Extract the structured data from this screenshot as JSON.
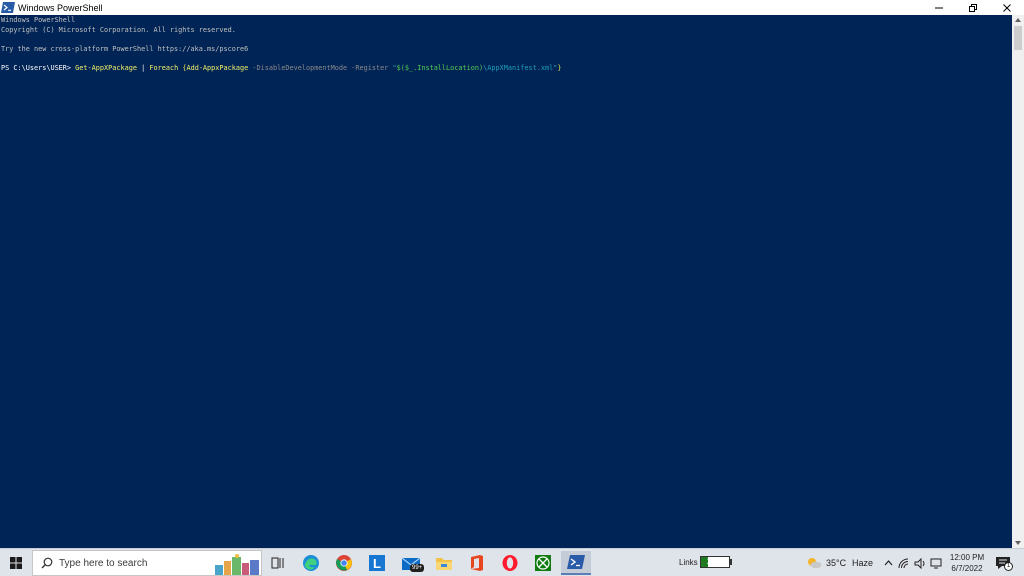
{
  "window": {
    "title": "Windows PowerShell"
  },
  "console": {
    "lines": [
      "Windows PowerShell",
      "Copyright (C) Microsoft Corporation. All rights reserved.",
      "",
      "Try the new cross-platform PowerShell https://aka.ms/pscore6",
      ""
    ],
    "prompt": "PS C:\\Users\\USER> ",
    "command": {
      "cmdlet1": "Get-AppXPackage",
      "pipe": " | ",
      "foreach": "Foreach",
      "space": " ",
      "open_brace": "{",
      "cmdlet2": "Add-AppxPackage",
      "param1": " -DisableDevelopmentMode",
      "param2": " -Register",
      "quote_open": " \"",
      "var_expr": "$($_.InstallLocation)",
      "path": "\\AppXManifest.xml",
      "quote_close": "\"",
      "close_brace": "}"
    }
  },
  "taskbar": {
    "search_placeholder": "Type here to search",
    "mail_badge": "99+",
    "links_label": "Links",
    "battery_percent": "25%",
    "battery_level": 0.25,
    "weather_temp": "35°C",
    "weather_desc": "Haze",
    "time": "12:00 PM",
    "date": "6/7/2022",
    "notification_count": "1"
  },
  "colors": {
    "console_bg": "#012456",
    "cmdlet": "#f1f167",
    "parameter": "#8a8a8a",
    "string": "#1e9fb7",
    "variable": "#4fcf4f"
  },
  "icons": {
    "title": "powershell-icon",
    "start": "windows-start-icon",
    "search": "search-icon",
    "task_view": "task-view-icon",
    "apps": [
      "edge-icon",
      "chrome-icon",
      "l-app-icon",
      "mail-icon",
      "file-explorer-icon",
      "office-icon",
      "opera-icon",
      "xbox-icon",
      "powershell-icon"
    ],
    "tray": [
      "weather-icon",
      "chevron-up-icon",
      "network-icon",
      "speaker-icon",
      "display-icon",
      "notification-icon"
    ]
  }
}
